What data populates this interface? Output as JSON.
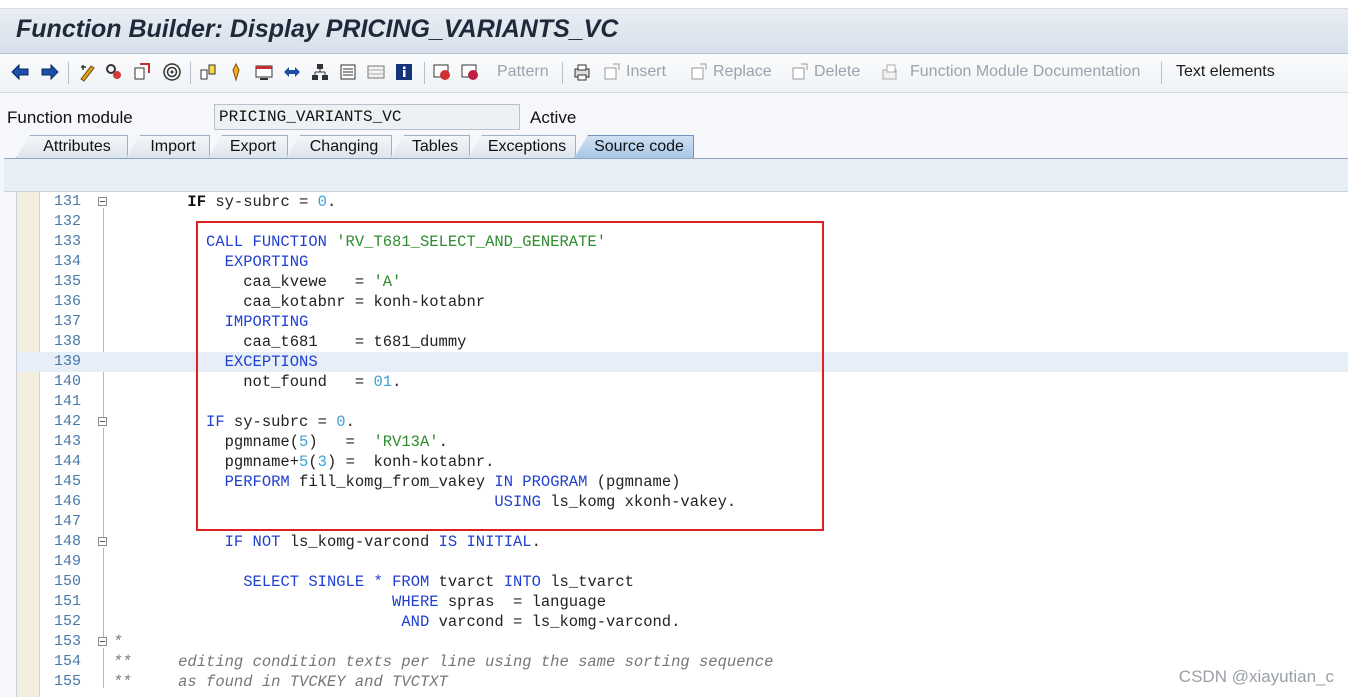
{
  "window": {
    "title": "Function Builder: Display PRICING_VARIANTS_VC"
  },
  "toolbar": {
    "pattern_label": "Pattern",
    "insert_label": "Insert",
    "replace_label": "Replace",
    "delete_label": "Delete",
    "fm_doc_label": "Function Module Documentation",
    "text_elements_label": "Text elements",
    "icons": [
      "back-icon",
      "forward-icon",
      "toggle-icon",
      "check-icon",
      "activate-icon",
      "test-icon",
      "where-used-icon",
      "other-object-icon",
      "display-object-list-icon",
      "navigation-icon",
      "hierarchy-icon",
      "window-icon",
      "info-icon",
      "breakpoint-icon",
      "external-breakpoint-icon",
      "pretty-printer-icon"
    ]
  },
  "function_module": {
    "label": "Function module",
    "value": "PRICING_VARIANTS_VC",
    "status": "Active"
  },
  "tabs": [
    "Attributes",
    "Import",
    "Export",
    "Changing",
    "Tables",
    "Exceptions",
    "Source code"
  ],
  "active_tab": "Source code",
  "editor": {
    "lines": [
      {
        "n": "131",
        "t": "IF sy-subrc = 0."
      },
      {
        "n": "132",
        "t": ""
      },
      {
        "n": "133",
        "t": "CALL FUNCTION 'RV_T681_SELECT_AND_GENERATE'"
      },
      {
        "n": "134",
        "t": "EXPORTING"
      },
      {
        "n": "135",
        "t": "caa_kvewe   = 'A'"
      },
      {
        "n": "136",
        "t": "caa_kotabnr = konh-kotabnr"
      },
      {
        "n": "137",
        "t": "IMPORTING"
      },
      {
        "n": "138",
        "t": "caa_t681    = t681_dummy"
      },
      {
        "n": "139",
        "t": "EXCEPTIONS"
      },
      {
        "n": "140",
        "t": "not_found   = 01."
      },
      {
        "n": "141",
        "t": ""
      },
      {
        "n": "142",
        "t": "IF sy-subrc = 0."
      },
      {
        "n": "143",
        "t": "pgmname(5)   =  'RV13A'."
      },
      {
        "n": "144",
        "t": "pgmname+5(3) =  konh-kotabnr."
      },
      {
        "n": "145",
        "t": "PERFORM fill_komg_from_vakey IN PROGRAM (pgmname)"
      },
      {
        "n": "146",
        "t": "USING ls_komg xkonh-vakey."
      },
      {
        "n": "147",
        "t": ""
      },
      {
        "n": "148",
        "t": "IF NOT ls_komg-varcond IS INITIAL."
      },
      {
        "n": "149",
        "t": ""
      },
      {
        "n": "150",
        "t": "SELECT SINGLE * FROM tvarct INTO ls_tvarct"
      },
      {
        "n": "151",
        "t": "WHERE spras  = language"
      },
      {
        "n": "152",
        "t": "AND varcond = ls_komg-varcond."
      },
      {
        "n": "153",
        "t": "*"
      },
      {
        "n": "154",
        "t": "**     editing condition texts per line using the same sorting sequence"
      },
      {
        "n": "155",
        "t": "**     as found in TVCKEY and TVCTXT"
      }
    ]
  },
  "watermark": "CSDN @xiayutian_c",
  "colors": {
    "keyword": "#1f3fd0",
    "string": "#2e8b2e",
    "number": "#3aa0d8",
    "highlight_box": "#e02020"
  }
}
